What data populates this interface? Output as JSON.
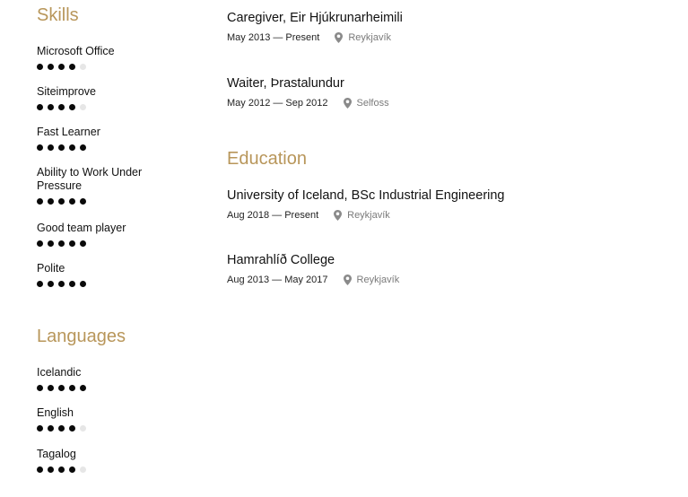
{
  "skills": {
    "heading": "Skills",
    "items": [
      {
        "name": "Microsoft Office",
        "level": 4,
        "max": 5
      },
      {
        "name": "Siteimprove",
        "level": 4,
        "max": 5
      },
      {
        "name": "Fast Learner",
        "level": 5,
        "max": 5
      },
      {
        "name": "Ability to Work Under Pressure",
        "level": 5,
        "max": 5
      },
      {
        "name": "Good team player",
        "level": 5,
        "max": 5
      },
      {
        "name": "Polite",
        "level": 5,
        "max": 5
      }
    ]
  },
  "languages": {
    "heading": "Languages",
    "items": [
      {
        "name": "Icelandic",
        "level": 5,
        "max": 5
      },
      {
        "name": "English",
        "level": 4,
        "max": 5
      },
      {
        "name": "Tagalog",
        "level": 4,
        "max": 5
      }
    ]
  },
  "experience": {
    "items": [
      {
        "title": "Caregiver, Eir Hjúkrunarheimili",
        "dates": "May 2013 — Present",
        "location": "Reykjavík"
      },
      {
        "title": "Waiter, Þrastalundur",
        "dates": "May 2012 — Sep 2012",
        "location": "Selfoss"
      }
    ]
  },
  "education": {
    "heading": "Education",
    "items": [
      {
        "title": "University of Iceland, BSc Industrial Engineering",
        "dates": "Aug 2018 — Present",
        "location": "Reykjavík"
      },
      {
        "title": "Hamrahlíð College",
        "dates": "Aug 2013 — May 2017",
        "location": "Reykjavík"
      }
    ]
  },
  "colors": {
    "accent": "#b8965a",
    "dot_filled": "#0a0a0a",
    "dot_empty": "#e6e6e6",
    "location_text": "#7a7a7a"
  },
  "icons": {
    "location": "map-pin-icon"
  }
}
